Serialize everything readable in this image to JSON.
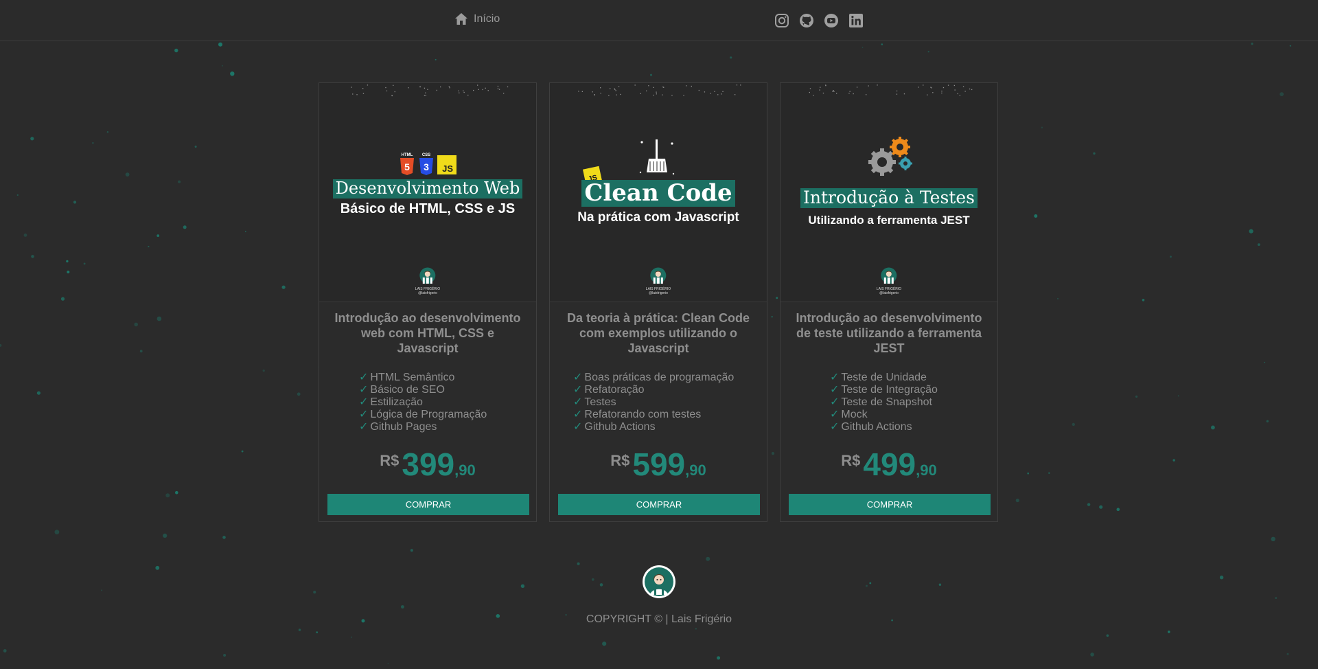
{
  "colors": {
    "background": "#2b2b2b",
    "accent": "#1e8676",
    "text": "#9a9a9a"
  },
  "nav": {
    "home_label": "Início",
    "social_icons": [
      "instagram-icon",
      "github-icon",
      "youtube-icon",
      "linkedin-icon"
    ]
  },
  "cards": [
    {
      "banner": {
        "highlight": "Desenvolvimento Web",
        "subtitle": "Básico de HTML, CSS e JS",
        "badges": [
          "HTML",
          "CSS",
          "JS"
        ]
      },
      "title": "Introdução ao desenvolvimento web com HTML, CSS e Javascript",
      "features": [
        "HTML Semântico",
        "Básico de SEO",
        "Estilização",
        "Lógica de Programação",
        "Github Pages"
      ],
      "price": {
        "currency": "R$",
        "integer": "399",
        "decimal": ",90"
      },
      "button_label": "COMPRAR"
    },
    {
      "banner": {
        "highlight": "Clean Code",
        "subtitle": "Na prática com Javascript",
        "badges": [
          "JS"
        ]
      },
      "title": "Da teoria à prática: Clean Code com exemplos utilizando o Javascript",
      "features": [
        "Boas práticas de programação",
        "Refatoração",
        "Testes",
        "Refatorando com testes",
        "Github Actions"
      ],
      "price": {
        "currency": "R$",
        "integer": "599",
        "decimal": ",90"
      },
      "button_label": "COMPRAR"
    },
    {
      "banner": {
        "highlight": "Introdução à Testes",
        "subtitle": "Utilizando a ferramenta JEST",
        "badges": []
      },
      "title": "Introdução ao desenvolvimento de teste utilizando a ferramenta JEST",
      "features": [
        "Teste de Unidade",
        "Teste de Integração",
        "Teste de Snapshot",
        "Mock",
        "Github Actions"
      ],
      "price": {
        "currency": "R$",
        "integer": "499",
        "decimal": ",90"
      },
      "button_label": "COMPRAR"
    }
  ],
  "banner_brand": {
    "name": "LAIS FRIGÉRIO",
    "handle": "@laisfrigerio"
  },
  "footer": {
    "copyright": "COPYRIGHT © | Lais Frigério"
  },
  "check_mark": "✓"
}
